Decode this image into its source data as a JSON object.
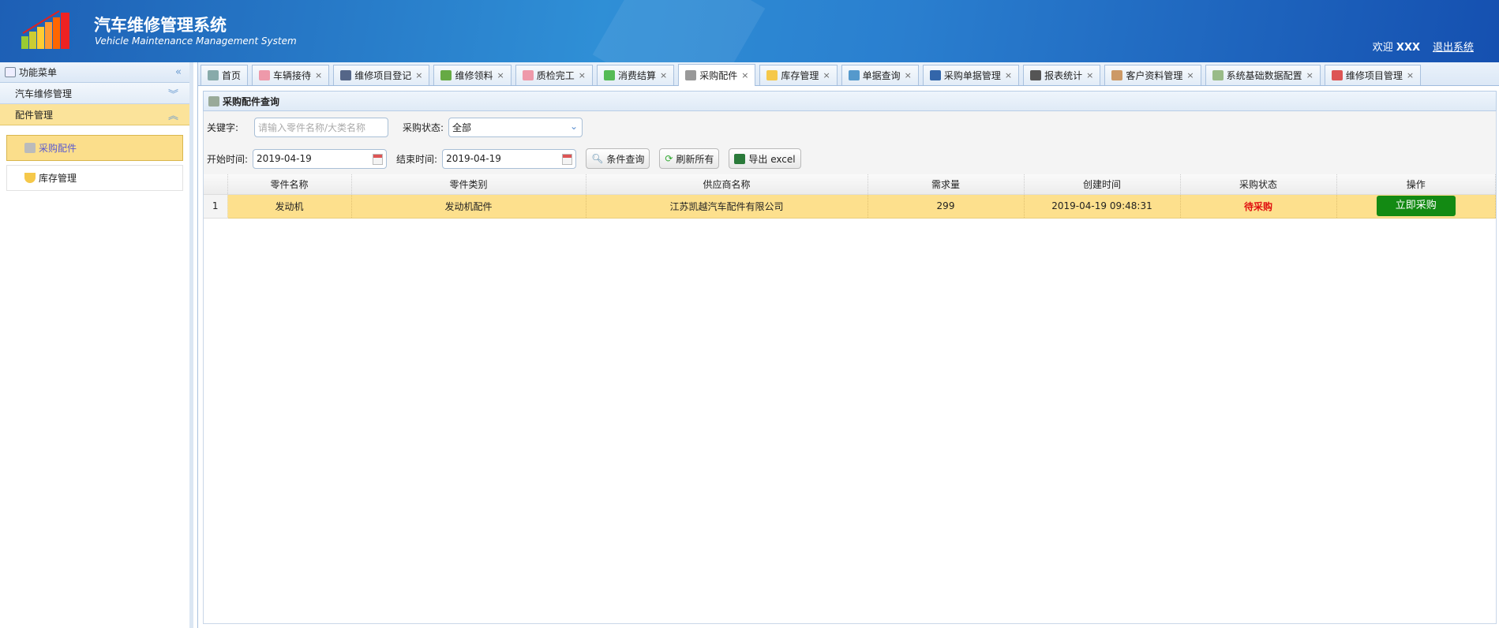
{
  "header": {
    "title_cn": "汽车维修管理系统",
    "title_en": "Vehicle Maintenance Management System",
    "welcome": "欢迎",
    "user": "XXX",
    "logout": "退出系统"
  },
  "sidebar": {
    "title": "功能菜单",
    "groups": [
      {
        "label": "汽车维修管理"
      },
      {
        "label": "配件管理"
      }
    ],
    "items": [
      {
        "label": "采购配件"
      },
      {
        "label": "库存管理"
      }
    ]
  },
  "tabs": [
    {
      "label": "首页",
      "icon": "home-icon"
    },
    {
      "label": "车辆接待",
      "icon": "edit-icon"
    },
    {
      "label": "维修项目登记",
      "icon": "car-icon"
    },
    {
      "label": "维修领料",
      "icon": "download-icon"
    },
    {
      "label": "质检完工",
      "icon": "edit-icon"
    },
    {
      "label": "消费结算",
      "icon": "money-icon"
    },
    {
      "label": "采购配件",
      "icon": "cart-icon"
    },
    {
      "label": "库存管理",
      "icon": "shield-icon"
    },
    {
      "label": "单据查询",
      "icon": "search-icon"
    },
    {
      "label": "采购单据管理",
      "icon": "word-icon"
    },
    {
      "label": "报表统计",
      "icon": "sigma-icon"
    },
    {
      "label": "客户资料管理",
      "icon": "user-icon"
    },
    {
      "label": "系统基础数据配置",
      "icon": "tag-icon"
    },
    {
      "label": "维修项目管理",
      "icon": "tool-icon"
    }
  ],
  "close_glyph": "×",
  "panel": {
    "title": "采购配件查询"
  },
  "filters": {
    "keyword_label": "关键字:",
    "keyword_placeholder": "请输入零件名称/大类名称",
    "status_label": "采购状态:",
    "status_value": "全部",
    "start_label": "开始时间:",
    "start_value": "2019-04-19",
    "end_label": "结束时间:",
    "end_value": "2019-04-19",
    "search_btn": "条件查询",
    "refresh_btn": "刷新所有",
    "export_btn": "导出 excel"
  },
  "table": {
    "columns": [
      "零件名称",
      "零件类别",
      "供应商名称",
      "需求量",
      "创建时间",
      "采购状态",
      "操作"
    ],
    "rows": [
      {
        "n": "1",
        "name": "发动机",
        "category": "发动机配件",
        "supplier": "江苏凯越汽车配件有限公司",
        "qty": "299",
        "created": "2019-04-19 09:48:31",
        "status": "待采购",
        "action": "立即采购"
      }
    ]
  }
}
